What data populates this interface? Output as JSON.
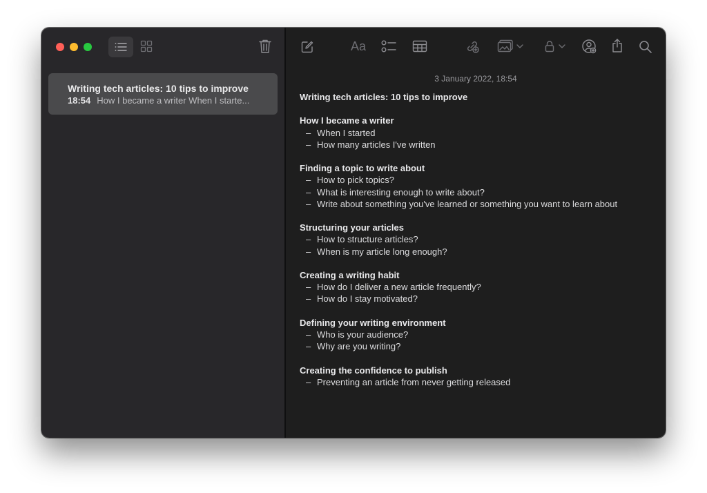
{
  "sidebar": {
    "note": {
      "title": "Writing tech articles: 10 tips to improve",
      "time": "18:54",
      "preview": "How I became a writer When I starte..."
    }
  },
  "editor": {
    "date": "3 January 2022, 18:54",
    "title": "Writing tech articles: 10 tips to improve",
    "sections": [
      {
        "heading": "How I became a writer",
        "items": [
          "When I started",
          "How many articles I've written"
        ]
      },
      {
        "heading": "Finding a topic to write about",
        "items": [
          "How to pick topics?",
          "What is interesting enough to write about?",
          "Write about something you've learned or something you want to learn about"
        ]
      },
      {
        "heading": "Structuring your articles",
        "items": [
          "How to structure articles?",
          "When is my article long enough?"
        ]
      },
      {
        "heading": "Creating a writing habit",
        "items": [
          "How do I deliver a new article frequently?",
          "How do I stay motivated?"
        ]
      },
      {
        "heading": "Defining your writing environment",
        "items": [
          "Who is your audience?",
          "Why are you writing?"
        ]
      },
      {
        "heading": "Creating the confidence to publish",
        "items": [
          "Preventing an article from never getting released"
        ]
      }
    ]
  },
  "toolbar": {
    "format_label": "Aa",
    "icons": [
      "list-view-icon",
      "gallery-view-icon",
      "trash-icon",
      "compose-icon",
      "format-text-icon",
      "checklist-icon",
      "table-icon",
      "collaborate-icon",
      "media-icon",
      "lock-icon",
      "share-with-people-icon",
      "share-icon",
      "search-icon"
    ]
  },
  "colors": {
    "sidebar_bg": "#28272a",
    "editor_bg": "#1e1e1e",
    "selected_note_bg": "#4a4a4c",
    "close": "#ff5f57",
    "minimize": "#febc2e",
    "maximize": "#28c840"
  }
}
